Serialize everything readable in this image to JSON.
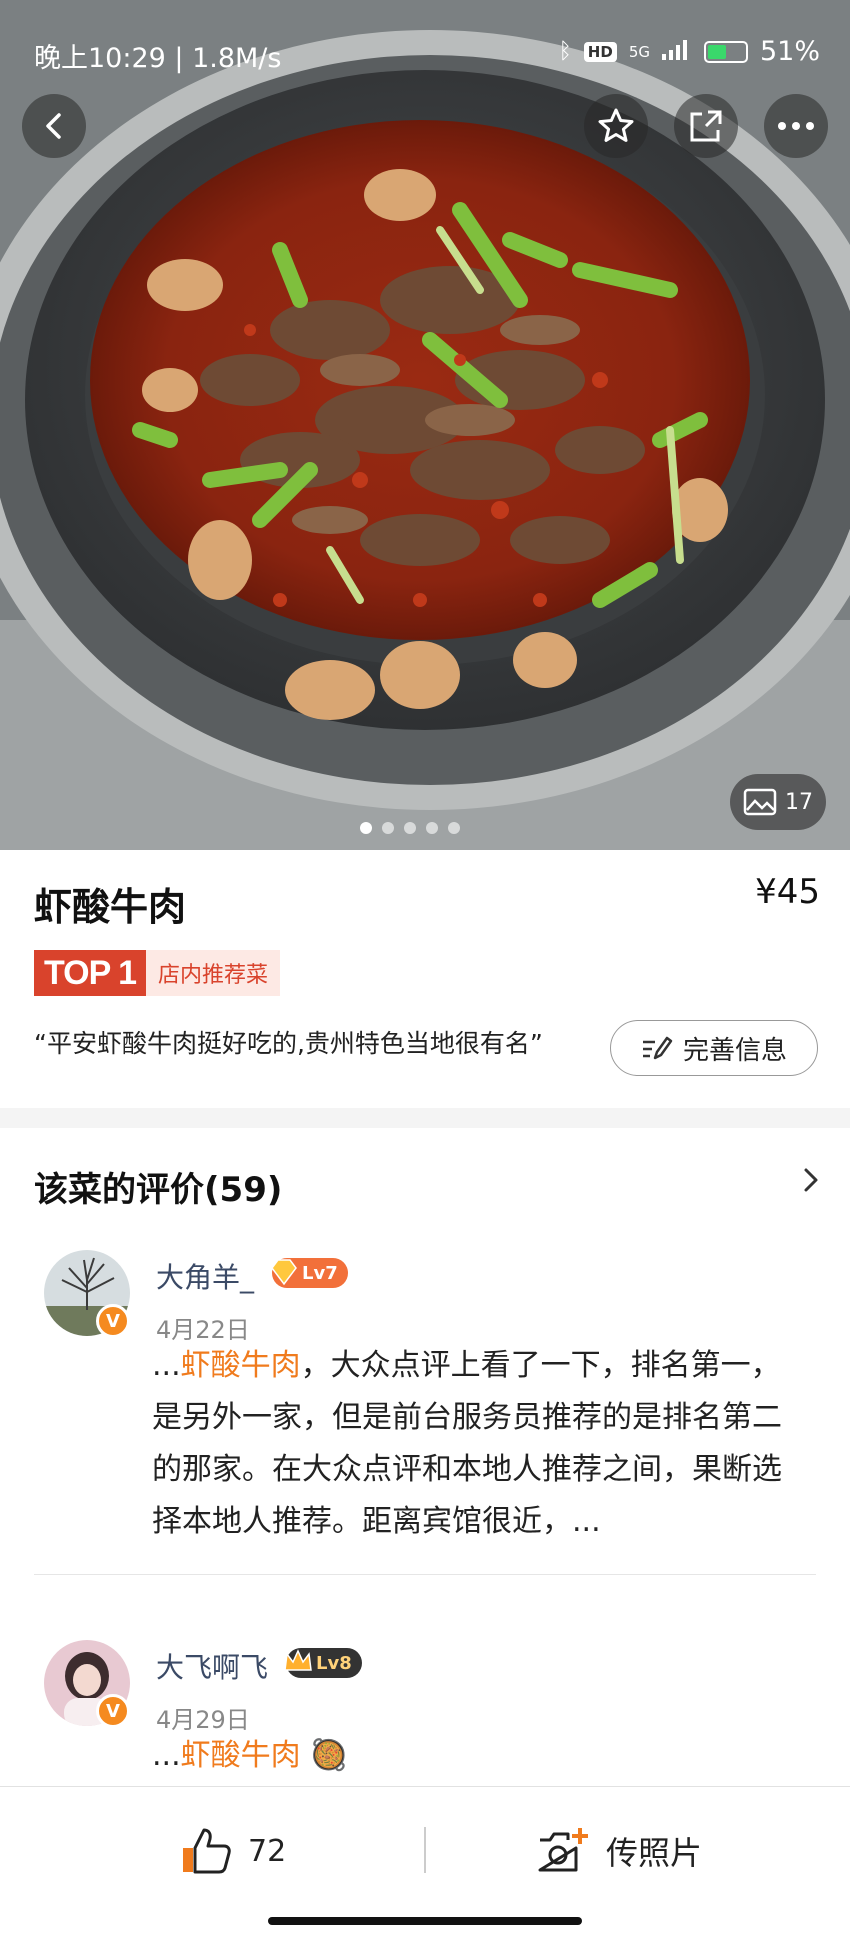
{
  "status_bar": {
    "time_speed": "晚上10:29 | 1.8M/s",
    "network": "5G",
    "hd": "HD",
    "battery": "51%",
    "battery_level": 0.51
  },
  "hero": {
    "photo_count": "17",
    "carousel_total": 5,
    "carousel_active": 0
  },
  "dish": {
    "name": "虾酸牛肉",
    "price": "¥45",
    "rank_badge": "TOP 1",
    "rank_text": "店内推荐菜",
    "quote": "“平安虾酸牛肉挺好吃的,贵州特色当地很有名”",
    "improve_label": "完善信息"
  },
  "reviews": {
    "title": "该菜的评价(59)",
    "items": [
      {
        "name": "大角羊_",
        "level": "Lv7",
        "date": "4月22日",
        "prefix": "...",
        "highlight": "虾酸牛肉",
        "text": "，大众点评上看了一下，排名第一，是另外一家，但是前台服务员推荐的是排名第二的那家。在大众点评和本地人推荐之间，果断选择本地人推荐。距离宾馆很近，..."
      },
      {
        "name": "大飞啊飞",
        "level": "Lv8",
        "date": "4月29日",
        "prefix": "...",
        "highlight": "虾酸牛肉",
        "text": " 🥘"
      }
    ]
  },
  "bottom_bar": {
    "like_count": "72",
    "upload_label": "传照片"
  },
  "colors": {
    "accent_orange": "#f07b1d",
    "rank_red": "#d9432c",
    "level_badge": "#ee5a3a"
  },
  "icons": [
    "back-arrow-icon",
    "star-icon",
    "share-icon",
    "more-icon",
    "image-icon",
    "edit-icon",
    "chevron-right-icon",
    "thumbs-up-icon",
    "camera-plus-icon"
  ]
}
